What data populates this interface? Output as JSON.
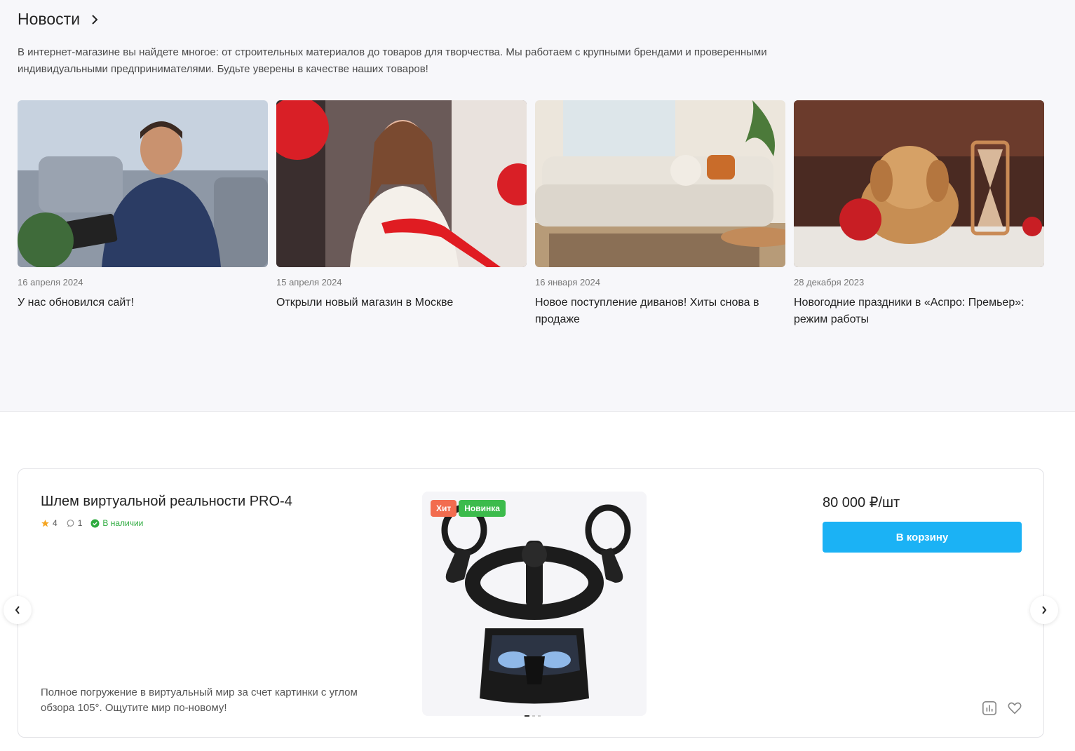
{
  "news": {
    "title": "Новости",
    "description": "В интернет-магазине вы найдете многое: от строительных материалов до товаров для творчества. Мы работаем с крупными брендами и проверенными индивидуальными предпринимателями. Будьте уверены в качестве наших товаров!",
    "items": [
      {
        "date": "16 апреля 2024",
        "title": "У нас обновился сайт!"
      },
      {
        "date": "15 апреля 2024",
        "title": "Открыли новый магазин в Москве"
      },
      {
        "date": "16 января 2024",
        "title": "Новое поступление диванов! Хиты снова в продаже"
      },
      {
        "date": "28 декабря 2023",
        "title": "Новогодние праздники в «Аспро: Премьер»: режим работы"
      }
    ]
  },
  "product": {
    "name": "Шлем виртуальной реальности PRO-4",
    "rating": "4",
    "reviews": "1",
    "stock": "В наличии",
    "description": "Полное погружение в виртуальный мир за счет картинки с углом обзора 105°. Ощутите мир по-новому!",
    "badges": {
      "hit": "Хит",
      "new": "Новинка"
    },
    "price": "80 000 ₽/шт",
    "cart_label": "В корзину"
  },
  "carousel": {
    "prev": "‹",
    "next": "›"
  },
  "colors": {
    "accent": "#1bb2f5",
    "hit": "#f26c4f",
    "new": "#3cbb4c",
    "stock": "#2eab3f"
  }
}
